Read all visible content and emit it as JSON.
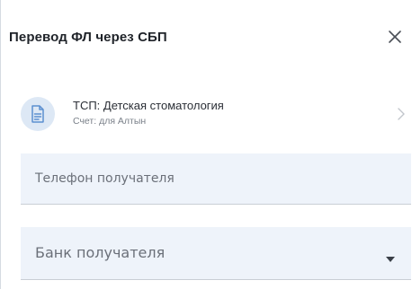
{
  "header": {
    "title": "Перевод ФЛ через СБП"
  },
  "account": {
    "title": "ТСП: Детская стоматология",
    "subtitle": "Счет: для Алтын"
  },
  "form": {
    "phone_placeholder": "Телефон получателя",
    "bank_placeholder": "Банк получателя"
  },
  "colors": {
    "field_bg": "#eef3fa",
    "icon_circle_bg": "#dde8f5",
    "icon_color": "#5c8fd0"
  }
}
